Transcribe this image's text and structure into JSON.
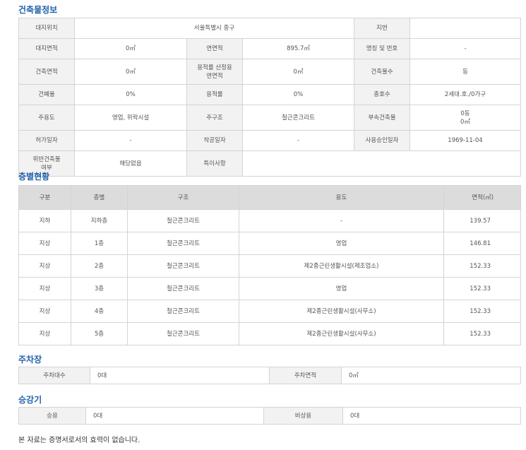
{
  "building_info": {
    "title": "건축물정보",
    "rows": [
      {
        "c": [
          {
            "t": "대지위치",
            "l": 1
          },
          {
            "t": "서울특별시 중구",
            "l": 0,
            "span": 3
          },
          {
            "t": "지번",
            "l": 1
          },
          {
            "t": "",
            "l": 0
          }
        ]
      },
      {
        "c": [
          {
            "t": "대지면적",
            "l": 1
          },
          {
            "t": "0㎡",
            "l": 0
          },
          {
            "t": "연면적",
            "l": 1
          },
          {
            "t": "895.7㎡",
            "l": 0
          },
          {
            "t": "명칭 및 번호",
            "l": 1
          },
          {
            "t": "-",
            "l": 0
          }
        ]
      },
      {
        "tall": true,
        "c": [
          {
            "t": "건축면적",
            "l": 1
          },
          {
            "t": "0㎡",
            "l": 0
          },
          {
            "t": "용적률 산정용\n연면적",
            "l": 1
          },
          {
            "t": "0㎡",
            "l": 0
          },
          {
            "t": "건축물수",
            "l": 1
          },
          {
            "t": "동",
            "l": 0
          }
        ]
      },
      {
        "c": [
          {
            "t": "건폐율",
            "l": 1
          },
          {
            "t": "0%",
            "l": 0
          },
          {
            "t": "용적률",
            "l": 1
          },
          {
            "t": "0%",
            "l": 0
          },
          {
            "t": "총호수",
            "l": 1
          },
          {
            "t": "2세대.호./0가구",
            "l": 0
          }
        ]
      },
      {
        "tall": true,
        "c": [
          {
            "t": "주용도",
            "l": 1
          },
          {
            "t": "영업, 위락시설",
            "l": 0
          },
          {
            "t": "주구조",
            "l": 1
          },
          {
            "t": "철근콘크리트",
            "l": 0
          },
          {
            "t": "부속건축물",
            "l": 1
          },
          {
            "t": "0동\n0㎡",
            "l": 0
          }
        ]
      },
      {
        "c": [
          {
            "t": "허가일자",
            "l": 1
          },
          {
            "t": "-",
            "l": 0
          },
          {
            "t": "착공일자",
            "l": 1
          },
          {
            "t": "-",
            "l": 0
          },
          {
            "t": "사용승인일자",
            "l": 1
          },
          {
            "t": "1969-11-04",
            "l": 0
          }
        ]
      },
      {
        "tall": true,
        "c": [
          {
            "t": "위반건축물\n여부",
            "l": 1
          },
          {
            "t": "해당없음",
            "l": 0
          },
          {
            "t": "특이사항",
            "l": 1
          },
          {
            "t": "",
            "l": 0,
            "span": 3
          }
        ]
      }
    ]
  },
  "floor_status": {
    "title": "층별현황",
    "headers": [
      "구분",
      "층별",
      "구조",
      "용도",
      "면적(㎡)"
    ],
    "rows": [
      [
        "지하",
        "지하층",
        "철근콘크리트",
        "-",
        "139.57"
      ],
      [
        "지상",
        "1층",
        "철근콘크리트",
        "영업",
        "146.81"
      ],
      [
        "지상",
        "2층",
        "철근콘크리트",
        "제2종근린생활시설(제조업소)",
        "152.33"
      ],
      [
        "지상",
        "3층",
        "철근콘크리트",
        "영업",
        "152.33"
      ],
      [
        "지상",
        "4층",
        "철근콘크리트",
        "제2종근린생활시설(사무소)",
        "152.33"
      ],
      [
        "지상",
        "5층",
        "철근콘크리트",
        "제2종근린생활시설(사무소)",
        "152.33"
      ]
    ]
  },
  "parking": {
    "title": "주차장",
    "count_label": "주차대수",
    "count_value": "0대",
    "area_label": "주차면적",
    "area_value": "0㎡"
  },
  "elevator": {
    "title": "승강기",
    "passenger_label": "승용",
    "passenger_value": "0대",
    "emergency_label": "비상용",
    "emergency_value": "0대"
  },
  "footer_note": "본 자료는 증명서로서의 효력이 없습니다."
}
